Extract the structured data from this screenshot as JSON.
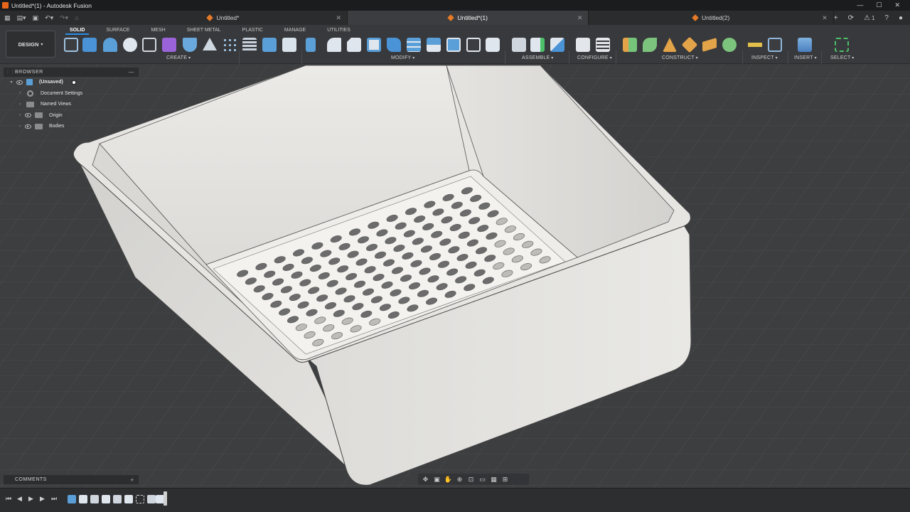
{
  "window": {
    "title": "Untitled*(1) - Autodesk Fusion"
  },
  "tabs": [
    {
      "label": "Untitled*",
      "active": false
    },
    {
      "label": "Untitled*(1)",
      "active": true
    },
    {
      "label": "Untitled(2)",
      "active": false
    }
  ],
  "tabbar": {
    "notification_count": "1"
  },
  "toolbar": {
    "workspace": "DESIGN",
    "workspace_tabs": [
      "SOLID",
      "SURFACE",
      "MESH",
      "SHEET METAL",
      "PLASTIC",
      "MANAGE",
      "UTILITIES"
    ],
    "active_tab": "SOLID",
    "groups": {
      "create": "CREATE",
      "modify": "MODIFY",
      "assemble": "ASSEMBLE",
      "configure": "CONFIGURE",
      "construct": "CONSTRUCT",
      "inspect": "INSPECT",
      "insert": "INSERT",
      "select": "SELECT"
    }
  },
  "browser": {
    "title": "BROWSER",
    "root": "(Unsaved)",
    "items": [
      "Document Settings",
      "Named Views",
      "Origin",
      "Bodies"
    ]
  },
  "comments": {
    "title": "COMMENTS"
  },
  "colors": {
    "accent": "#2a8de8",
    "brand": "#e8661c",
    "model": "#e7e6e3"
  }
}
